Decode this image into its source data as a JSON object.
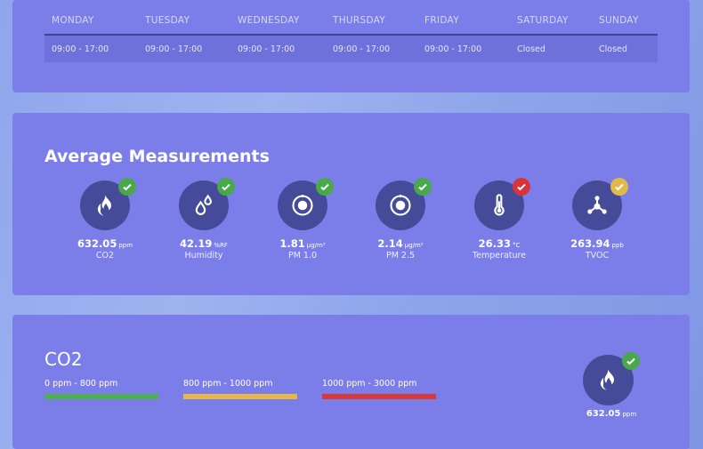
{
  "hours": {
    "days": [
      "MONDAY",
      "TUESDAY",
      "WEDNESDAY",
      "THURSDAY",
      "FRIDAY",
      "SATURDAY",
      "SUNDAY"
    ],
    "times": [
      "09:00 - 17:00",
      "09:00 - 17:00",
      "09:00 - 17:00",
      "09:00 - 17:00",
      "09:00 - 17:00",
      "Closed",
      "Closed"
    ]
  },
  "measurements": {
    "title": "Average Measurements",
    "items": [
      {
        "value": "632.05",
        "unit": "ppm",
        "label": "CO2",
        "icon": "flame-icon",
        "status": "good"
      },
      {
        "value": "42.19",
        "unit": "%RF",
        "label": "Humidity",
        "icon": "droplets-icon",
        "status": "good"
      },
      {
        "value": "1.81",
        "unit": "µg/m³",
        "label": "PM 1.0",
        "icon": "particle-icon",
        "status": "good"
      },
      {
        "value": "2.14",
        "unit": "µg/m³",
        "label": "PM 2.5",
        "icon": "particle-icon",
        "status": "good"
      },
      {
        "value": "26.33",
        "unit": "°C",
        "label": "Temperature",
        "icon": "thermometer-icon",
        "status": "bad"
      },
      {
        "value": "263.94",
        "unit": "ppb",
        "label": "TVOC",
        "icon": "molecule-icon",
        "status": "warn"
      }
    ]
  },
  "co2_detail": {
    "title": "CO2",
    "ranges": [
      {
        "label": "0 ppm - 800 ppm",
        "color": "#4caf50"
      },
      {
        "label": "800 ppm - 1000 ppm",
        "color": "#e6b84a"
      },
      {
        "label": "1000 ppm - 3000 ppm",
        "color": "#d83a3a"
      }
    ],
    "value": "632.05",
    "unit": "ppm",
    "status": "good"
  }
}
